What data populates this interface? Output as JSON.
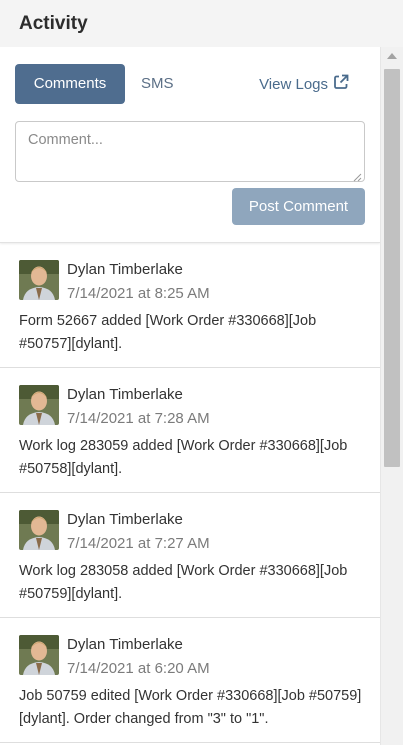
{
  "header": {
    "title": "Activity"
  },
  "tabs": [
    {
      "label": "Comments",
      "active": true
    },
    {
      "label": "SMS",
      "active": false
    }
  ],
  "view_logs": {
    "label": "View Logs",
    "icon": "external-link-icon"
  },
  "comment": {
    "placeholder": "Comment...",
    "value": ""
  },
  "post_button": {
    "label": "Post Comment"
  },
  "colors": {
    "accent": "#4f6d8f",
    "post_button_disabled": "#8fa6bd"
  },
  "entries": [
    {
      "author": "Dylan Timberlake",
      "time": "7/14/2021 at 8:25 AM",
      "text": "Form 52667 added [Work Order #330668][Job #50757][dylant]."
    },
    {
      "author": "Dylan Timberlake",
      "time": "7/14/2021 at 7:28 AM",
      "text": "Work log 283059 added [Work Order #330668][Job #50758][dylant]."
    },
    {
      "author": "Dylan Timberlake",
      "time": "7/14/2021 at 7:27 AM",
      "text": "Work log 283058 added [Work Order #330668][Job #50759][dylant]."
    },
    {
      "author": "Dylan Timberlake",
      "time": "7/14/2021 at 6:20 AM",
      "text": "Job 50759 edited [Work Order #330668][Job #50759][dylant]. Order changed from \"3\" to \"1\"."
    }
  ]
}
